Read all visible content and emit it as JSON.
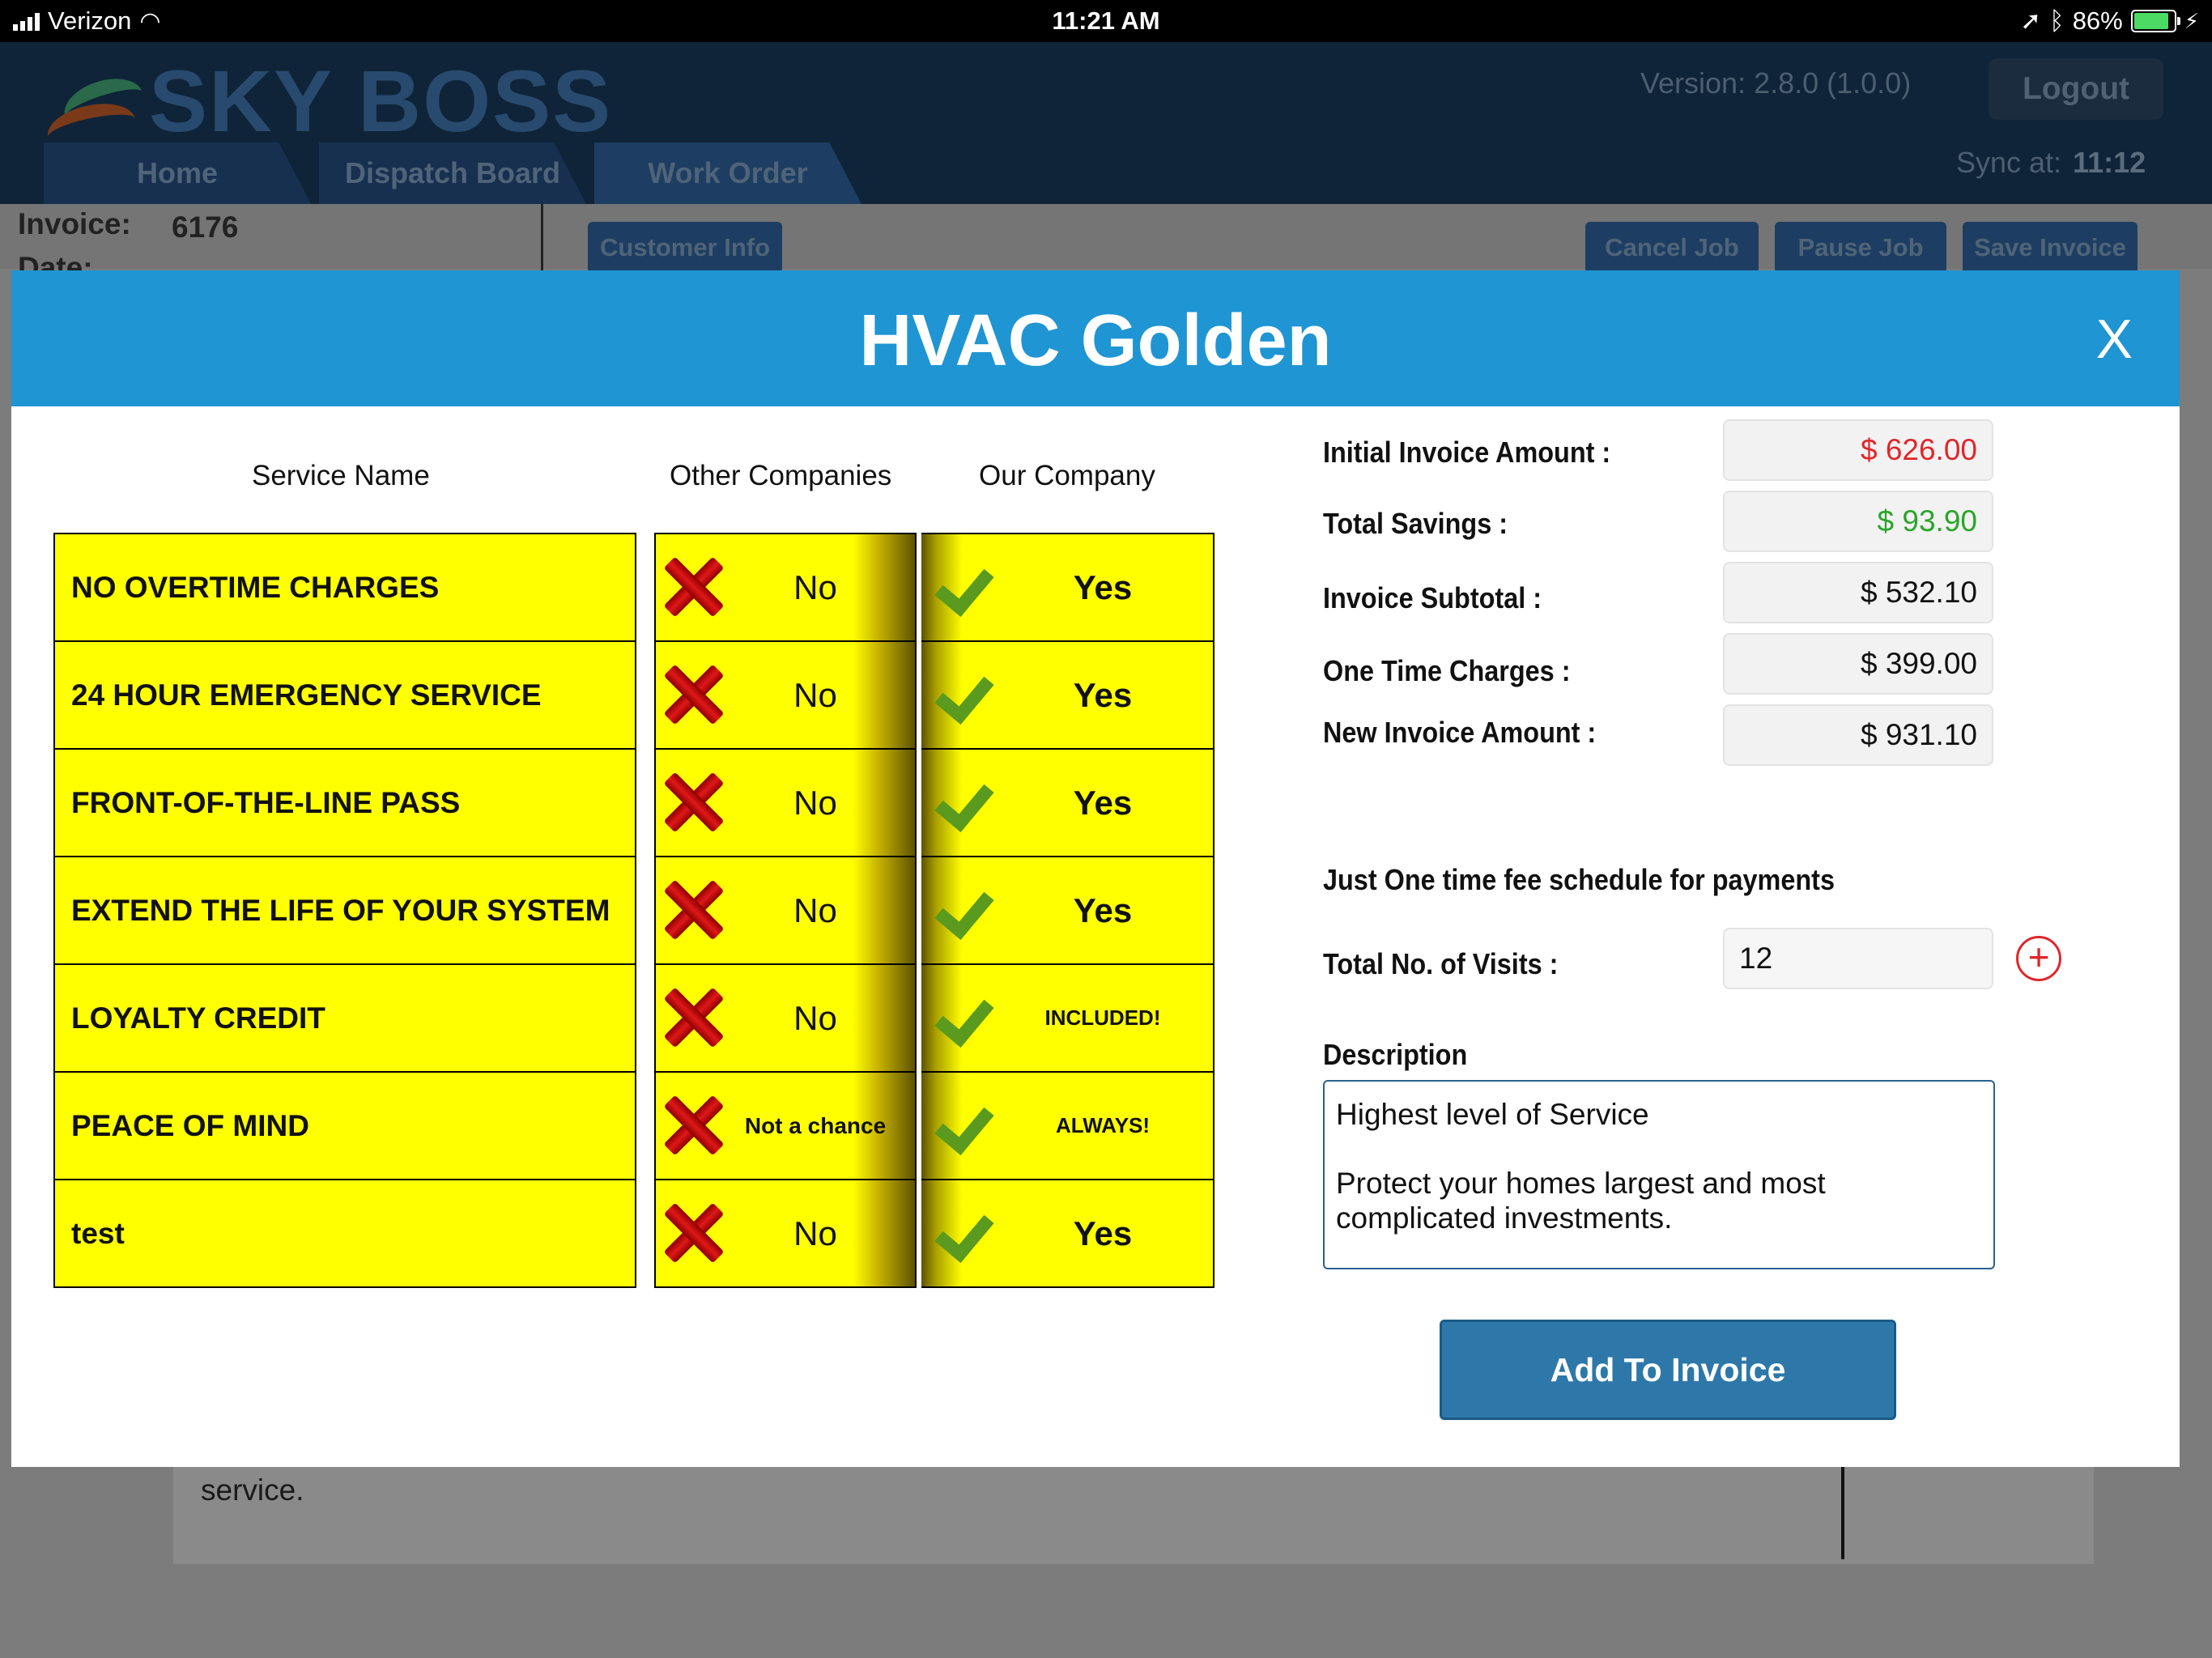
{
  "status_bar": {
    "carrier": "Verizon",
    "time": "11:21 AM",
    "battery": "86%"
  },
  "app": {
    "logo": "SKY BOSS",
    "version": "Version: 2.8.0 (1.0.0)",
    "logout_label": "Logout",
    "sync_label": "Sync at:",
    "sync_time": "11:12",
    "tabs": [
      {
        "label": "Home"
      },
      {
        "label": "Dispatch Board"
      },
      {
        "label": "Work Order"
      }
    ],
    "invoice_label": "Invoice:",
    "invoice_number": "6176",
    "date_label": "Date:",
    "buttons": {
      "customer_info": "Customer Info",
      "cancel_job": "Cancel Job",
      "pause_job": "Pause Job",
      "save_invoice": "Save Invoice"
    },
    "background_text": "service."
  },
  "modal": {
    "title": "HVAC Golden",
    "close_label": "X",
    "columns": {
      "service": "Service Name",
      "other": "Other Companies",
      "ours": "Our Company"
    },
    "rows": [
      {
        "service": "NO OVERTIME CHARGES",
        "other": "No",
        "ours": "Yes"
      },
      {
        "service": "24 HOUR EMERGENCY SERVICE",
        "other": "No",
        "ours": "Yes"
      },
      {
        "service": "FRONT-OF-THE-LINE PASS",
        "other": "No",
        "ours": "Yes"
      },
      {
        "service": "EXTEND THE LIFE OF YOUR SYSTEM",
        "other": "No",
        "ours": "Yes"
      },
      {
        "service": "LOYALTY CREDIT",
        "other": "No",
        "ours": "INCLUDED!"
      },
      {
        "service": "PEACE OF MIND",
        "other": "Not a chance",
        "ours": "ALWAYS!"
      },
      {
        "service": "test",
        "other": "No",
        "ours": "Yes"
      }
    ],
    "summary": {
      "initial_label": "Initial Invoice Amount :",
      "initial_value": "$ 626.00",
      "savings_label": "Total Savings :",
      "savings_value": "$ 93.90",
      "subtotal_label": "Invoice Subtotal :",
      "subtotal_value": "$ 532.10",
      "onetime_label": "One Time Charges :",
      "onetime_value": "$ 399.00",
      "new_label": "New Invoice Amount :",
      "new_value": "$ 931.10"
    },
    "schedule_label": "Just One time fee schedule for payments",
    "visits_label": "Total No. of Visits :",
    "visits_value": "12",
    "description_label": "Description",
    "description_text": "Highest level of Service\n\nProtect your homes largest and most complicated investments.",
    "add_button": "Add To Invoice",
    "colors": {
      "header": "#1f95d3",
      "cell": "#ffff00",
      "initial_amount": "#e0262b",
      "savings_amount": "#2aa52a",
      "button": "#2d78a8"
    }
  }
}
